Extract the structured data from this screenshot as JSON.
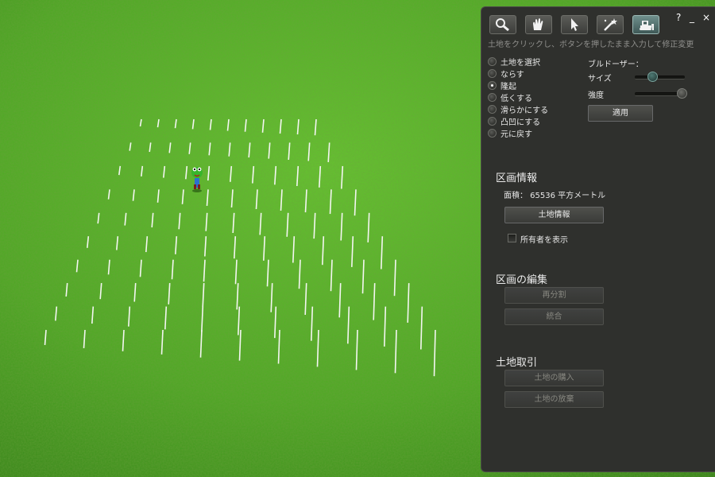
{
  "toolbar": {
    "tools": [
      {
        "icon": "magnifier-icon"
      },
      {
        "icon": "grab-hand-icon"
      },
      {
        "icon": "arrow-pointer-icon"
      },
      {
        "icon": "magic-wand-icon"
      },
      {
        "icon": "bulldozer-icon",
        "active": true
      }
    ],
    "help": "?",
    "minimize": "_",
    "close": "×"
  },
  "hint": "土地をクリックし、ボタンを押したまま入力して修正変更",
  "modes": [
    {
      "label": "土地を選択",
      "selected": false
    },
    {
      "label": "ならす",
      "selected": false
    },
    {
      "label": "隆起",
      "selected": true
    },
    {
      "label": "低くする",
      "selected": false
    },
    {
      "label": "滑らかにする",
      "selected": false
    },
    {
      "label": "凸凹にする",
      "selected": false
    },
    {
      "label": "元に戻す",
      "selected": false
    }
  ],
  "bulldozer": {
    "title": "ブルドーザー：",
    "size_label": "サイズ",
    "size_level": 0.35,
    "strength_label": "強度",
    "strength_level": 0.95,
    "apply": "適用"
  },
  "parcel_info": {
    "title": "区画情報",
    "area": "面積： 65536 平方メートル",
    "land_info_button": "土地情報",
    "show_owners": "所有者を表示"
  },
  "parcel_edit": {
    "title": "区画の編集",
    "subdivide": "再分割",
    "join": "統合"
  },
  "land_deal": {
    "title": "土地取引",
    "buy": "土地の購入",
    "abandon": "土地の放棄"
  },
  "colors": {
    "grass_light": "#5fc22c",
    "grass_dark": "#2f7a14",
    "panel_bg": "#2f302d",
    "accent": "#4f7a74"
  }
}
